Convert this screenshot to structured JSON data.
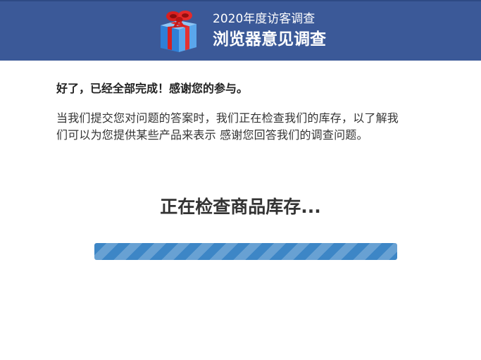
{
  "header": {
    "subtitle": "2020年度访客调查",
    "title": "浏览器意见调查",
    "icon": "gift-box-icon",
    "background_color": "#3b5998"
  },
  "main": {
    "thanks_text": "好了，已经全部完成！感谢您的参与。",
    "message_line1": "当我们提交您对问题的答案时，我们正在检查我们的库存，以了解我",
    "message_line2": "们可以为您提供某些产品来表示 感谢您回答我们的调查问题。",
    "status_text": "正在检查商品库存...",
    "progress": {
      "fraction": 1.0,
      "color": "#3d86c6",
      "striped": true
    }
  }
}
